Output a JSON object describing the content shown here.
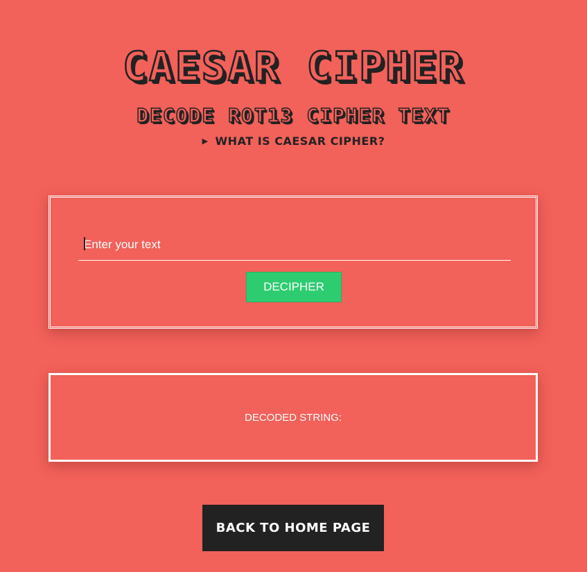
{
  "header": {
    "title": "CAESAR CIPHER",
    "subtitle": "DECODE ROT13 CIPHER TEXT",
    "info_toggle": "WHAT IS CAESAR CIPHER?"
  },
  "form": {
    "placeholder": "Enter your text",
    "value": "",
    "submit_label": "DECIPHER"
  },
  "output": {
    "label": "DECODED STRING:"
  },
  "footer": {
    "home_label": "BACK TO HOME PAGE"
  },
  "colors": {
    "background": "#f2615a",
    "dark": "#222222",
    "button_green": "#2ecc71",
    "border_white": "#ffffff"
  },
  "icons": {
    "info_toggle": "triangle-right-icon"
  }
}
